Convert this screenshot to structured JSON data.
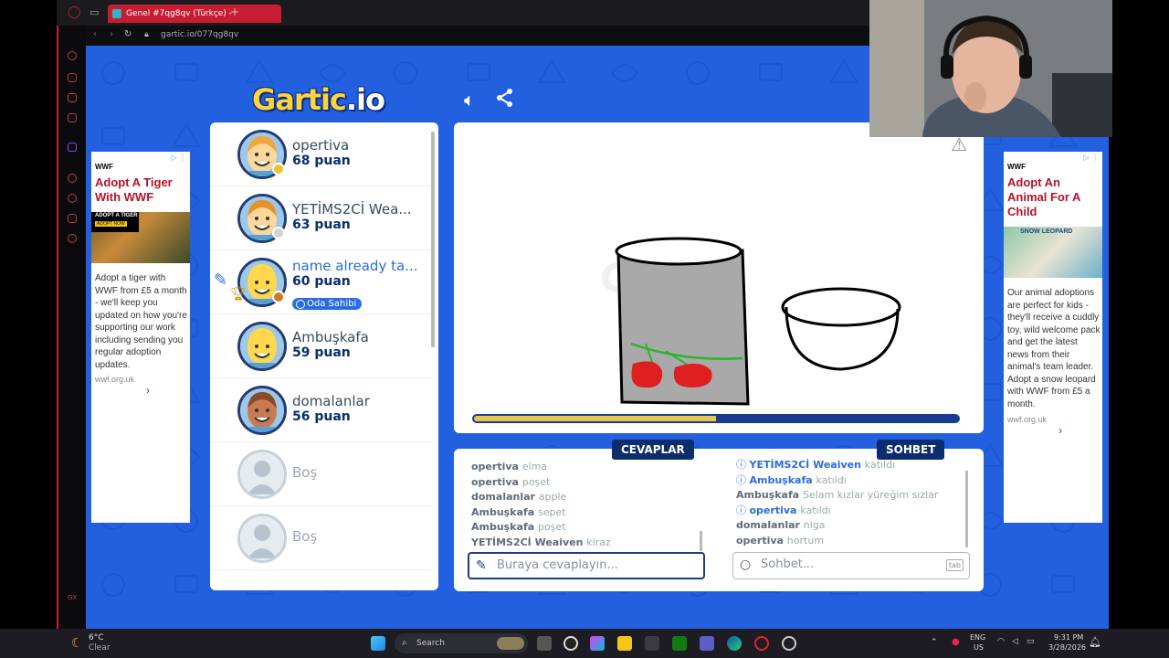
{
  "browser": {
    "tab_title": "Genel #7qg8qv (Türkçe) -",
    "url": "gartic.io/077qg8qv"
  },
  "logo": {
    "text_main": "Gartic",
    "text_suffix": ".io"
  },
  "players": [
    {
      "name": "opertiva",
      "score": "68 puan",
      "dot_color": "#f2c12e",
      "skin": "#fcd79b",
      "hair": "#f2a53a"
    },
    {
      "name": "YETİMS2Cİ Weaven",
      "display_name": "YETİMS2Cİ Wea...",
      "score": "63 puan",
      "dot_color": "#cfd3d8",
      "skin": "#fcd79b",
      "hair": "#e8902a"
    },
    {
      "name": "name already taken",
      "display_name": "name already ta...",
      "score": "60 puan",
      "dot_color": "#d57a1c",
      "skin": "#ffd84d",
      "hair": "#ffd84d",
      "badge": "Oda Sahibi"
    },
    {
      "name": "Ambuşkafa",
      "score": "59 puan",
      "skin": "#ffd84d",
      "hair": "#ffd84d"
    },
    {
      "name": "domalanlar",
      "score": "56 puan",
      "skin": "#c97a55",
      "hair": "#8a4a2a"
    },
    {
      "name": "Boş"
    },
    {
      "name": "Boş"
    }
  ],
  "answers": {
    "header": "CEVAPLAR",
    "lines": [
      {
        "user": "opertiva",
        "text": "elma"
      },
      {
        "user": "opertiva",
        "text": "poşet"
      },
      {
        "user": "domalanlar",
        "text": "apple"
      },
      {
        "user": "Ambuşkafa",
        "text": "sepet"
      },
      {
        "user": "Ambuşkafa",
        "text": "poşet"
      },
      {
        "user": "YETİMS2Cİ Weaiven",
        "text": "kiraz"
      }
    ],
    "placeholder": "Buraya cevaplayın..."
  },
  "chat": {
    "header": "SOHBET",
    "lines": [
      {
        "user": "YETİMS2Cİ Weaiven",
        "text": "katıldı",
        "system": true
      },
      {
        "user": "Ambuşkafa",
        "text": "katıldı",
        "system": true
      },
      {
        "user": "Ambuşkafa",
        "text": "Selam kızlar yüreğim sızlar",
        "system": false
      },
      {
        "user": "opertiva",
        "text": "katıldı",
        "system": true
      },
      {
        "user": "domalanlar",
        "text": "niga",
        "system": false
      },
      {
        "user": "opertiva",
        "text": "hortum",
        "system": false
      }
    ],
    "placeholder": "Sohbet...",
    "key_hint": "tab"
  },
  "timer": {
    "progress": 0.5
  },
  "ad_left": {
    "brand": "WWF",
    "title": "Adopt A Tiger With WWF",
    "image_text": "ADOPT A TIGER",
    "image_btn": "ADOPT NOW",
    "body": "Adopt a tiger with WWF from £5 a month - we'll keep you updated on how you're supporting our work including sending you regular adoption updates.",
    "link": "wwf.org.uk"
  },
  "ad_right": {
    "brand": "WWF",
    "title": "Adopt An Animal For A Child",
    "image_text": "SNOW LEOPARD",
    "body": "Our animal adoptions are perfect for kids - they'll receive a cuddly toy, wild welcome pack and get the latest news from their animal's team leader. Adopt a snow leopard with WWF from £5 a month.",
    "link": "wwf.org.uk"
  },
  "taskbar": {
    "weather_temp": "6°C",
    "weather_desc": "Clear",
    "search": "Search",
    "lang": "ENG",
    "region": "US",
    "time": "9:31 PM",
    "date": "3/28/2026"
  },
  "colors": {
    "page_bg": "#2260e0",
    "header_navy": "#0b2d6e",
    "accent_blue": "#2a6ce0",
    "timer_fill": "#e6c84a",
    "ad_red": "#b5132b"
  }
}
